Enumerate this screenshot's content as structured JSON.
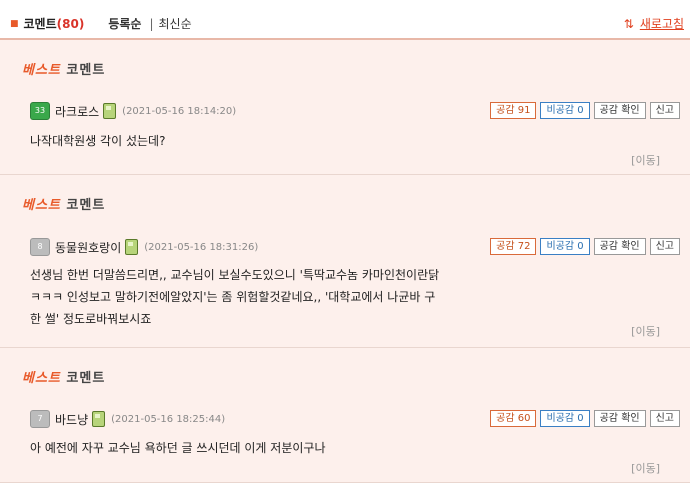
{
  "header": {
    "title": "코멘트",
    "count": "(80)",
    "sort_registered": "등록순",
    "divider": "|",
    "sort_latest": "최신순",
    "refresh_label": "새로고침",
    "refresh_icon": "refresh-arrows-icon"
  },
  "best_label": {
    "word": "베스트",
    "tail": " 코멘트"
  },
  "comments": [
    {
      "level": "33",
      "nickname": "라크로스",
      "date": "(2021-05-16 18:14:20)",
      "like": "공감 91",
      "dislike": "비공감 0",
      "check": "공감 확인",
      "report": "신고",
      "lines": [
        "나작대학원생 각이 섰는데?"
      ],
      "move": "[이동]"
    },
    {
      "level": "8",
      "nickname": "동물원호랑이",
      "date": "(2021-05-16 18:31:26)",
      "like": "공감 72",
      "dislike": "비공감 0",
      "check": "공감 확인",
      "report": "신고",
      "lines": [
        "선생님 한번 더말씀드리면,, 교수님이 보실수도있으니 '특딱교수놈 카마인천이란닭",
        "ㅋㅋㅋ 인성보고 말하기전에알았지'는 좀 위험할것같네요,, '대학교에서 나균바 구",
        "한 썰' 정도로바꿔보시죠"
      ],
      "move": "[이동]"
    },
    {
      "level": "7",
      "nickname": "바드냥",
      "date": "(2021-05-16 18:25:44)",
      "like": "공감 60",
      "dislike": "비공감 0",
      "check": "공감 확인",
      "report": "신고",
      "lines": [
        "아 예전에 자꾸 교수님 욕하던 글 쓰시던데 이게 저분이구나"
      ],
      "move": "[이동]"
    }
  ]
}
